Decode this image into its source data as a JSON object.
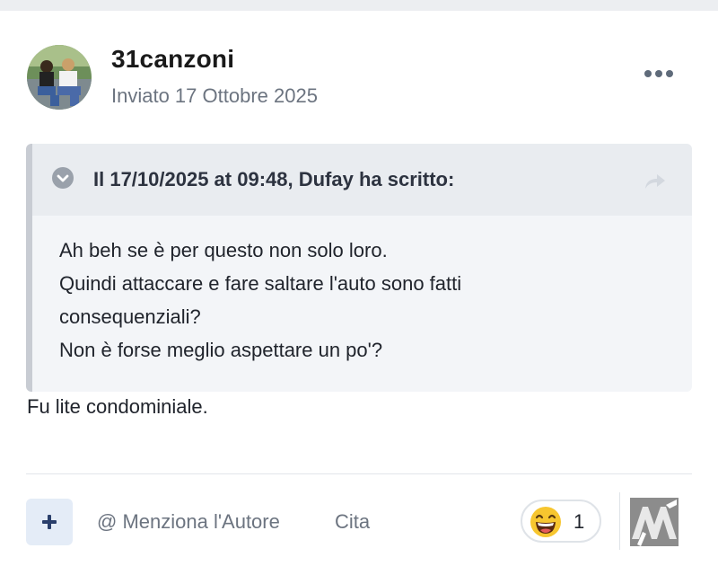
{
  "post": {
    "author": "31canzoni",
    "posted": "Inviato 17 Ottobre 2025",
    "more_icon": "ellipsis-icon"
  },
  "quote": {
    "title": "Il 17/10/2025 at 09:48, Dufay ha scritto:",
    "lines": [
      "Ah beh se è per questo non solo loro.",
      "Quindi attaccare e fare saltare l'auto sono fatti",
      "consequenziali?",
      "Non è forse meglio aspettare un po'?"
    ]
  },
  "reply": "Fu lite condominiale.",
  "actions": {
    "mention": "@ Menziona l'Autore",
    "quote": "Cita"
  },
  "reaction": {
    "emoji": "laughing-face-icon",
    "count": "1"
  },
  "colors": {
    "accent": "#2a3f6b",
    "muted_text": "#6c7480",
    "quote_bg": "#f3f5f8",
    "quote_header_bg": "#e9ecf0"
  }
}
